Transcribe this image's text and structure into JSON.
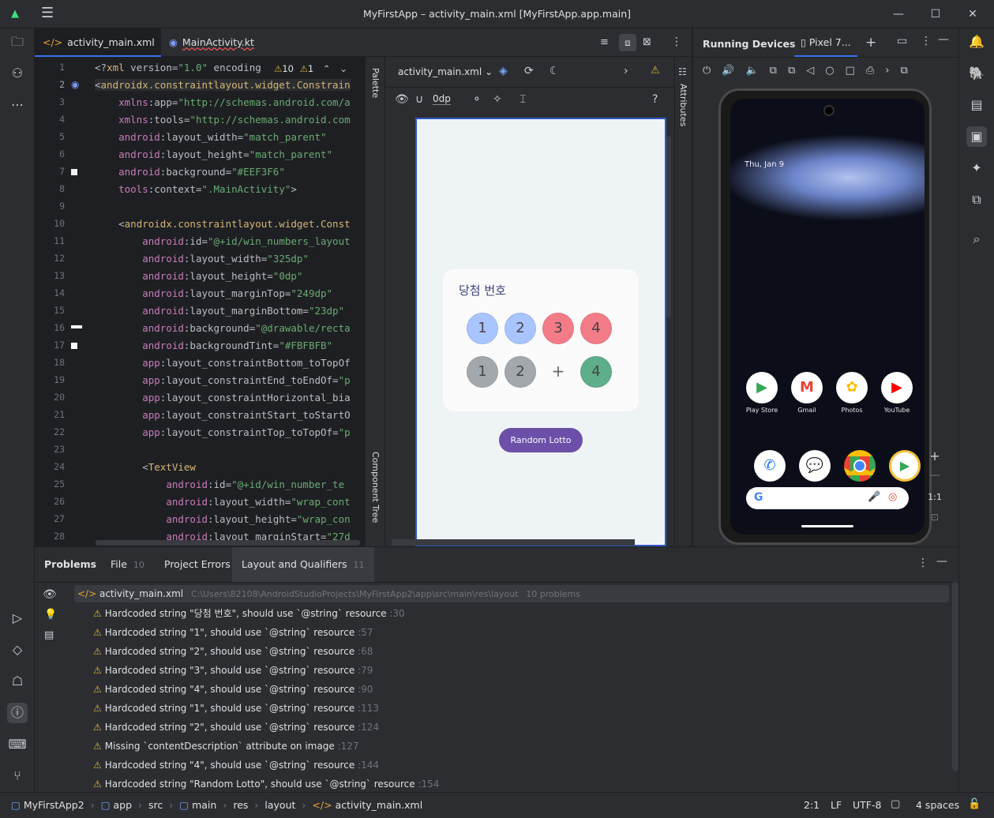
{
  "window": {
    "title": "MyFirstApp – activity_main.xml [MyFirstApp.app.main]"
  },
  "editor_tabs": [
    {
      "label": "activity_main.xml",
      "active": true
    },
    {
      "label": "MainActivity.kt",
      "active": false
    }
  ],
  "code": {
    "warnings_count": "10",
    "weak_count": "1",
    "line_numbers": [
      "1",
      "2",
      "3",
      "4",
      "5",
      "6",
      "7",
      "8",
      "9",
      "10",
      "11",
      "12",
      "13",
      "14",
      "15",
      "16",
      "17",
      "18",
      "19",
      "20",
      "21",
      "22",
      "23",
      "24",
      "25",
      "26",
      "27",
      "28"
    ],
    "lines": [
      "<?xml version=\"1.0\" encoding",
      "<androidx.constraintlayout.widget.Constrain",
      "    xmlns:app=\"http://schemas.android.com/a",
      "    xmlns:tools=\"http://schemas.android.com",
      "    android:layout_width=\"match_parent\"",
      "    android:layout_height=\"match_parent\"",
      "    android:background=\"#EEF3F6\"",
      "    tools:context=\".MainActivity\">",
      "",
      "    <androidx.constraintlayout.widget.Const",
      "        android:id=\"@+id/win_numbers_layout",
      "        android:layout_width=\"325dp\"",
      "        android:layout_height=\"0dp\"",
      "        android:layout_marginTop=\"249dp\"",
      "        android:layout_marginBottom=\"23dp\"",
      "        android:background=\"@drawable/recta",
      "        android:backgroundTint=\"#FBFBFB\"",
      "        app:layout_constraintBottom_toTopOf",
      "        app:layout_constraintEnd_toEndOf=\"p",
      "        app:layout_constraintHorizontal_bia",
      "        app:layout_constraintStart_toStartO",
      "        app:layout_constraintTop_toTopOf=\"p",
      "",
      "        <TextView",
      "            android:id=\"@+id/win_number_te",
      "            android:layout_width=\"wrap_cont",
      "            android:layout_height=\"wrap_con",
      "            android:layout_marginStart=\"27d"
    ]
  },
  "design": {
    "file_dropdown": "activity_main.xml",
    "margin_value": "0dp",
    "side_labels": {
      "palette": "Palette",
      "component_tree": "Component Tree",
      "attributes": "Attributes"
    },
    "preview": {
      "card_title": "당첨 번호",
      "row1": [
        "1",
        "2",
        "3",
        "4"
      ],
      "row2": [
        "1",
        "2",
        "+",
        "4"
      ],
      "button_label": "Random Lotto",
      "colors": {
        "bg": "#EEF3F6",
        "card": "#FBFBFB",
        "blue": "#A9C5FF",
        "red": "#F37C88",
        "gray": "#A3A8AC",
        "green": "#5FAE8A",
        "button": "#6B4FA8"
      }
    }
  },
  "running_devices": {
    "title": "Running Devices",
    "device_tab": "Pixel 7...",
    "phone": {
      "date": "Thu, Jan 9",
      "row1_apps": [
        "Play Store",
        "Gmail",
        "Photos",
        "YouTube"
      ],
      "zoom_label": "1:1"
    }
  },
  "problems": {
    "tabs": [
      {
        "label": "Problems",
        "count": ""
      },
      {
        "label": "File",
        "count": "10"
      },
      {
        "label": "Project Errors",
        "count": ""
      },
      {
        "label": "Layout and Qualifiers",
        "count": "11"
      }
    ],
    "file_name": "activity_main.xml",
    "file_path": "C:\\Users\\82108\\AndroidStudioProjects\\MyFirstApp2\\app\\src\\main\\res\\layout",
    "file_count": "10 problems",
    "items": [
      {
        "text": "Hardcoded string \"당첨 번호\", should use `@string` resource",
        "line": ":30"
      },
      {
        "text": "Hardcoded string \"1\", should use `@string` resource",
        "line": ":57"
      },
      {
        "text": "Hardcoded string \"2\", should use `@string` resource",
        "line": ":68"
      },
      {
        "text": "Hardcoded string \"3\", should use `@string` resource",
        "line": ":79"
      },
      {
        "text": "Hardcoded string \"4\", should use `@string` resource",
        "line": ":90"
      },
      {
        "text": "Hardcoded string \"1\", should use `@string` resource",
        "line": ":113"
      },
      {
        "text": "Hardcoded string \"2\", should use `@string` resource",
        "line": ":124"
      },
      {
        "text": "Missing `contentDescription` attribute on image",
        "line": ":127"
      },
      {
        "text": "Hardcoded string \"4\", should use `@string` resource",
        "line": ":144"
      },
      {
        "text": "Hardcoded string \"Random Lotto\", should use `@string` resource",
        "line": ":154"
      }
    ]
  },
  "statusbar": {
    "breadcrumb": [
      "MyFirstApp2",
      "app",
      "src",
      "main",
      "res",
      "layout",
      "activity_main.xml"
    ],
    "position": "2:1",
    "line_sep": "LF",
    "encoding": "UTF-8",
    "indent": "4 spaces"
  }
}
